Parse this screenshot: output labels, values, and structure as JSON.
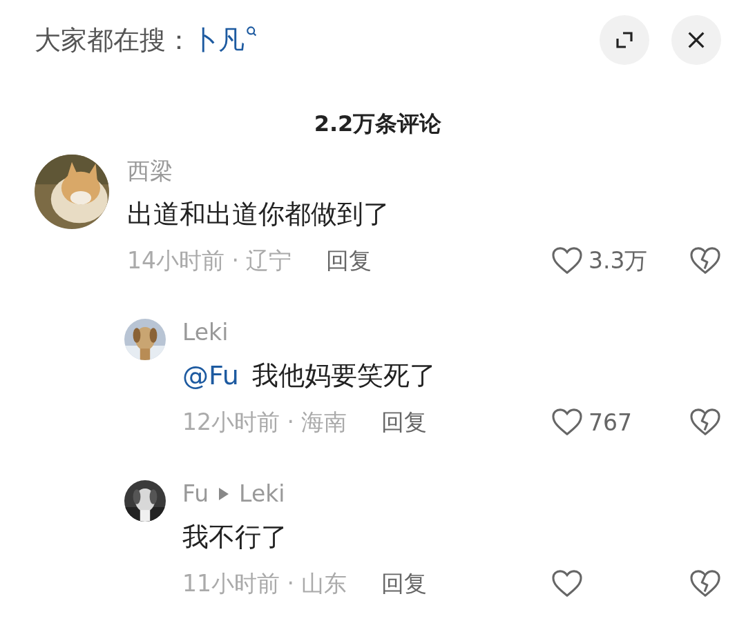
{
  "search_bar": {
    "label": "大家都在搜：",
    "query": "卜凡"
  },
  "comments_title": "2.2万条评论",
  "comments": [
    {
      "name": "西梁",
      "text": "出道和出道你都做到了",
      "time": "14小时前 · 辽宁",
      "reply": "回复",
      "likes": "3.3万",
      "children": [
        {
          "name": "Leki",
          "mention": "@Fu",
          "text": "我他妈要笑死了",
          "time": "12小时前 · 海南",
          "reply": "回复",
          "likes": "767"
        },
        {
          "name": "Fu",
          "reply_to": "Leki",
          "text": "我不行了",
          "time": "11小时前 · 山东",
          "reply": "回复"
        }
      ]
    }
  ]
}
